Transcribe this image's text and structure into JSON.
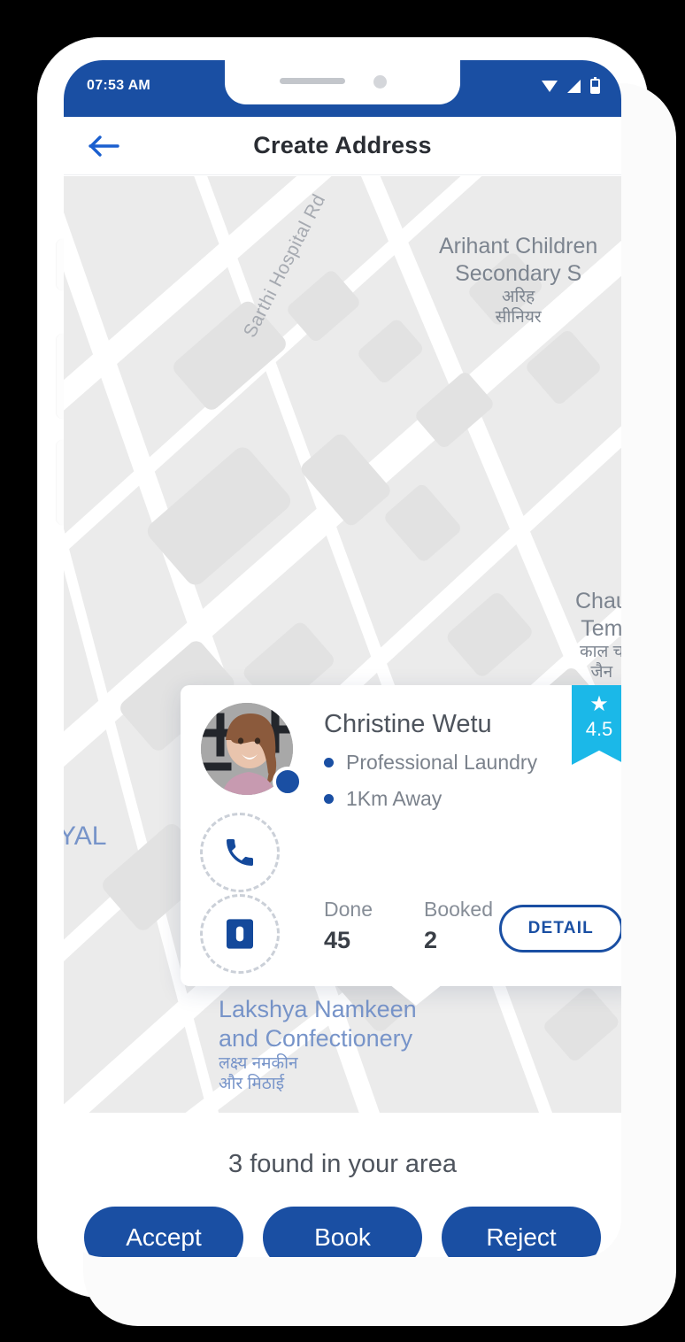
{
  "status_bar": {
    "time": "07:53 AM",
    "icons": [
      "wifi-icon",
      "signal-icon",
      "battery-icon"
    ]
  },
  "header": {
    "title": "Create Address",
    "back_icon": "back-arrow-icon"
  },
  "map": {
    "labels": [
      {
        "id": "school",
        "text": "Arihant Children",
        "text2": "Secondary S",
        "hindi": "अरिह",
        "hindi2": "सीनियर"
      },
      {
        "id": "road",
        "text": "Sarthi Hospital Rd"
      },
      {
        "id": "temple",
        "text": "Chau",
        "text2": "Tem",
        "hindi": "काल च",
        "hindi2": "जैन"
      },
      {
        "id": "yal",
        "text": "YAL"
      },
      {
        "id": "namkeen",
        "text": "Lakshya Namkeen",
        "text2": "and Confectionery",
        "hindi": "लक्ष्य नमकीन",
        "hindi2": "और मिठाई"
      }
    ],
    "location_marker": "current-location-marker"
  },
  "provider_card": {
    "name": "Christine Wetu",
    "avatar": "provider-avatar",
    "online": true,
    "meta": [
      "Professional Laundry",
      "1Km Away"
    ],
    "rating": {
      "value": "4.5",
      "star": "★"
    },
    "actions": {
      "call_icon": "phone-icon",
      "chat_icon": "message-icon"
    },
    "stats": [
      {
        "label": "Done",
        "value": "45"
      },
      {
        "label": "Booked",
        "value": "2"
      }
    ],
    "detail_label": "DETAIL"
  },
  "bottom": {
    "found_text": "3 found in your area",
    "buttons": [
      {
        "label": "Accept"
      },
      {
        "label": "Book"
      },
      {
        "label": "Reject"
      }
    ]
  },
  "colors": {
    "primary_blue": "#1a4fa3",
    "accent_cyan": "#1bb8e8",
    "map_bg": "#ebebeb",
    "map_label": "#7c848f",
    "map_label_blue": "#7794c9"
  }
}
